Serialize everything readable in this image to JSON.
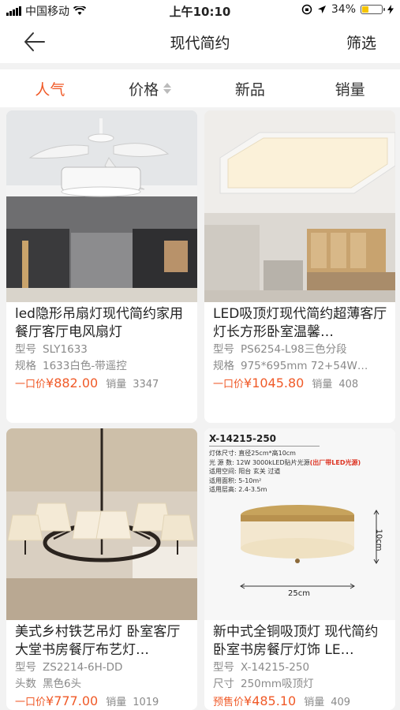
{
  "status": {
    "carrier": "中国移动",
    "time": "上午10:10",
    "battery": "34%",
    "battery_level": 0.34
  },
  "nav": {
    "title": "现代简约",
    "filter": "筛选"
  },
  "sort": {
    "tabs": [
      "人气",
      "价格",
      "新品",
      "销量"
    ],
    "active": 0
  },
  "colors": {
    "accent": "#f05a28",
    "muted": "#8a8a8a"
  },
  "products": [
    {
      "name": "led隐形吊扇灯现代简约家用餐厅客厅电风扇灯",
      "spec1_k": "型号",
      "spec1_v": "SLY1633",
      "spec2_k": "规格",
      "spec2_v": "1633白色-带遥控",
      "price_label": "一口价",
      "price": "¥882.00",
      "sold_label": "销量",
      "sold": "3347",
      "icon": "ceiling-fan-lamp-photo"
    },
    {
      "name": "LED吸顶灯现代简约超薄客厅灯长方形卧室温馨…",
      "spec1_k": "型号",
      "spec1_v": "PS6254-L98三色分段",
      "spec2_k": "规格",
      "spec2_v": "975*695mm 72+54W…",
      "price_label": "一口价",
      "price": "¥1045.80",
      "sold_label": "销量",
      "sold": "408",
      "icon": "rectangular-ceiling-light-photo"
    },
    {
      "name": "美式乡村铁艺吊灯 卧室客厅大堂书房餐厅布艺灯…",
      "spec1_k": "型号",
      "spec1_v": "ZS2214-6H-DD",
      "spec2_k": "头数",
      "spec2_v": "黑色6头",
      "price_label": "一口价",
      "price": "¥777.00",
      "sold_label": "销量",
      "sold": "1019",
      "icon": "chandelier-photo"
    },
    {
      "name": "新中式全铜吸顶灯 现代简约卧室书房餐厅灯饰 LE…",
      "spec1_k": "型号",
      "spec1_v": "X-14215-250",
      "spec2_k": "尺寸",
      "spec2_v": "250mm吸顶灯",
      "price_label": "预售价",
      "price": "¥485.10",
      "sold_label": "销量",
      "sold": "409",
      "icon": "round-ceiling-light-photo",
      "image_text": {
        "model": "X-14215-250",
        "lines": [
          "灯体尺寸: 直径25cm*高10cm",
          "光 源 数: 12W 3000kLED贴片光源",
          "适用空间: 阳台 玄关 过道",
          "适用面积: 5-10m²",
          "适用层高: 2.4-3.5m"
        ],
        "highlight": "(出厂带LED光源)",
        "height": "10cm",
        "width": "25cm"
      }
    }
  ]
}
